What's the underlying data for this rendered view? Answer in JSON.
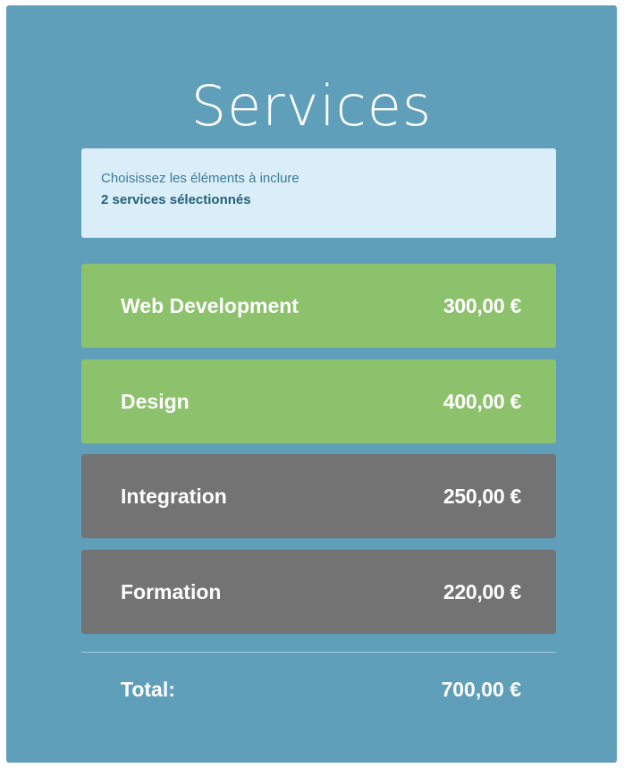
{
  "title": "Services",
  "info": {
    "hint": "Choisissez les éléments à inclure",
    "selected_count": "2 services sélectionnés"
  },
  "services": [
    {
      "name": "Web Development",
      "price": "300,00 €",
      "selected": true
    },
    {
      "name": "Design",
      "price": "400,00 €",
      "selected": true
    },
    {
      "name": "Integration",
      "price": "250,00 €",
      "selected": false
    },
    {
      "name": "Formation",
      "price": "220,00 €",
      "selected": false
    }
  ],
  "total": {
    "label": "Total:",
    "value": "700,00 €"
  },
  "colors": {
    "panel": "#609fba",
    "info_box": "#d9eef8",
    "selected": "#8cc26b",
    "unselected": "#737373",
    "text_light": "#ffffff"
  }
}
